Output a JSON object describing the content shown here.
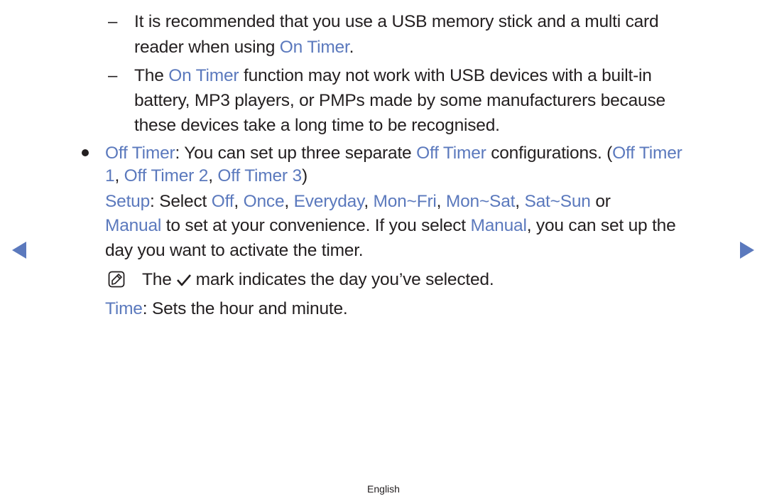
{
  "notes": [
    {
      "prefix": "It is recommended that you use a USB memory stick and a multi card",
      "line2_pre": "reader when using ",
      "hl": "On Timer",
      "line2_post": "."
    },
    {
      "pre": "The ",
      "hl": "On Timer",
      "post": " function may not work with USB devices with a built-in",
      "line2": "battery, MP3 players, or PMPs made by some manufacturers because",
      "line3": "these devices take a long time to be recognised."
    }
  ],
  "offtimer": {
    "term": "Off Timer",
    "desc": ": You can set up three separate ",
    "term2": "Off Timer",
    "desc2": " configurations. (",
    "term3": "Off Timer",
    "line2_a": "1",
    "sep1": ", ",
    "line2_b": "Off Timer 2",
    "sep2": ", ",
    "line2_c": "Off Timer 3",
    "close": ")"
  },
  "setup": {
    "term": "Setup",
    "text1": ": Select ",
    "opts": [
      "Off",
      "Once",
      "Everyday",
      "Mon~Fri",
      "Mon~Sat",
      "Sat~Sun"
    ],
    "comma": ", ",
    "or": " or",
    "manual": "Manual",
    "text2": " to set at your convenience. If you select ",
    "manual2": "Manual",
    "text3": ", you can set up the",
    "line3": "day you want to activate the timer."
  },
  "note": {
    "pre": "The",
    "post": "mark indicates the day you’ve selected."
  },
  "time": {
    "term": "Time",
    "desc": ": Sets the hour and minute."
  },
  "footer": {
    "language": "English"
  },
  "nav": {
    "prev": "previous-page",
    "next": "next-page"
  }
}
